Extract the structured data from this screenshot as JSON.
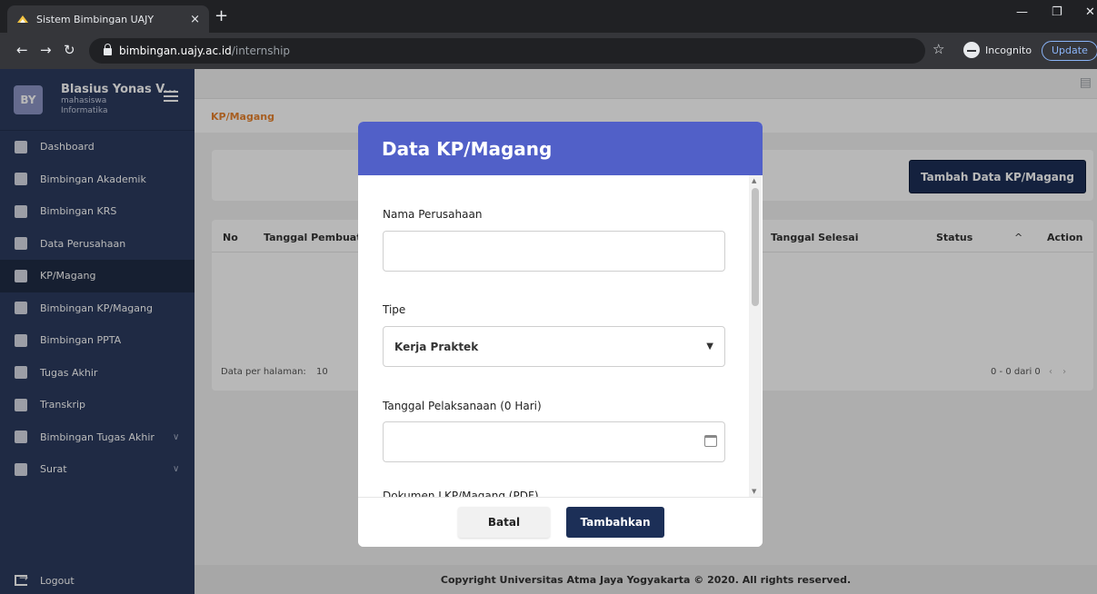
{
  "browser": {
    "tab_title": "Sistem Bimbingan UAJY",
    "tab_close": "×",
    "new_tab": "+",
    "url_host": "bimbingan.uajy.ac.id",
    "url_path": "/internship",
    "incognito": "Incognito",
    "update": "Update"
  },
  "sidebar": {
    "avatar_initials": "BY",
    "user_name": "Blasius Yonas V...",
    "user_role_line1": "mahasiswa",
    "user_role_line2": "Informatika",
    "items": [
      {
        "label": "Dashboard"
      },
      {
        "label": "Bimbingan Akademik"
      },
      {
        "label": "Bimbingan KRS"
      },
      {
        "label": "Data Perusahaan"
      },
      {
        "label": "KP/Magang"
      },
      {
        "label": "Bimbingan KP/Magang"
      },
      {
        "label": "Bimbingan PPTA"
      },
      {
        "label": "Tugas Akhir"
      },
      {
        "label": "Transkrip"
      },
      {
        "label": "Bimbingan Tugas Akhir"
      },
      {
        "label": "Surat"
      }
    ],
    "logout": "Logout"
  },
  "main": {
    "breadcrumb": "KP/Magang",
    "add_button": "Tambah Data KP/Magang",
    "table_headers": {
      "no": "No",
      "created": "Tanggal Pembuata",
      "end": "Tanggal Selesai",
      "status": "Status",
      "sort": "^",
      "action": "Action"
    },
    "per_page_label": "Data per halaman:",
    "per_page_value": "10",
    "pagination": "0 - 0 dari 0",
    "footer": "Copyright Universitas Atma Jaya Yogyakarta © 2020. All rights reserved."
  },
  "modal": {
    "title": "Data KP/Magang",
    "field_company_label": "Nama Perusahaan",
    "field_company_value": "",
    "field_type_label": "Tipe",
    "field_type_value": "Kerja Praktek",
    "field_date_label": "Tanggal Pelaksanaan (0 Hari)",
    "field_date_value": "",
    "field_report_label": "Dokumen LKP/Magang (PDF)",
    "cancel": "Batal",
    "submit": "Tambahkan"
  },
  "colors": {
    "sidebar": "#2b3b5f",
    "modal_header": "#5160c8",
    "primary_button": "#1c2f57",
    "breadcrumb": "#e8832e"
  }
}
